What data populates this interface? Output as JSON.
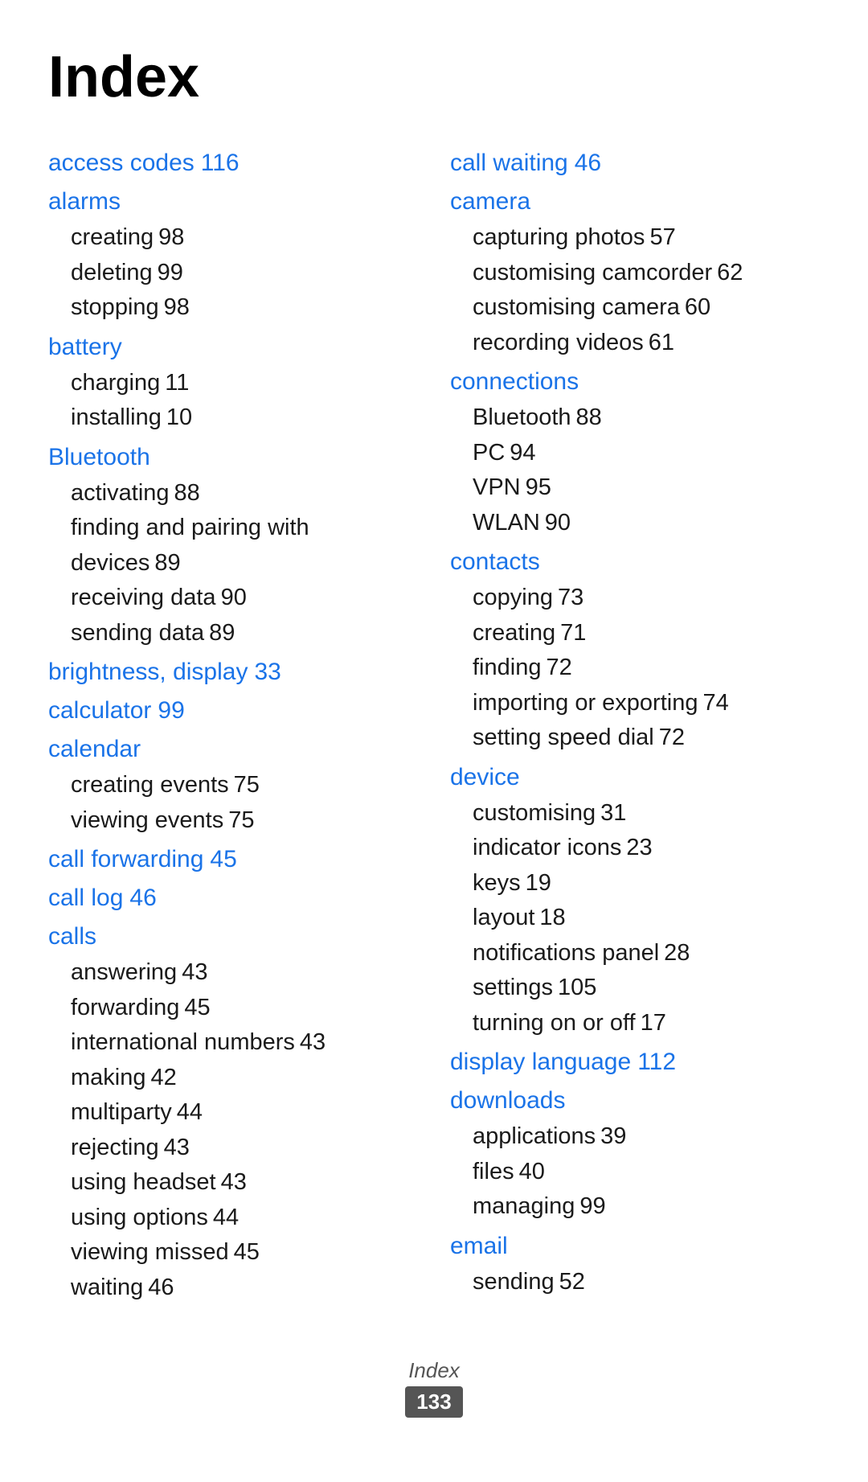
{
  "title": "Index",
  "columns": [
    {
      "entries": [
        {
          "label": "access codes",
          "page": "116",
          "subs": []
        },
        {
          "label": "alarms",
          "page": "",
          "subs": [
            {
              "text": "creating",
              "page": "98"
            },
            {
              "text": "deleting",
              "page": "99"
            },
            {
              "text": "stopping",
              "page": "98"
            }
          ]
        },
        {
          "label": "battery",
          "page": "",
          "subs": [
            {
              "text": "charging",
              "page": "11"
            },
            {
              "text": "installing",
              "page": "10"
            }
          ]
        },
        {
          "label": "Bluetooth",
          "page": "",
          "subs": [
            {
              "text": "activating",
              "page": "88"
            },
            {
              "text": "finding and pairing with devices",
              "page": "89"
            },
            {
              "text": "receiving data",
              "page": "90"
            },
            {
              "text": "sending data",
              "page": "89"
            }
          ]
        },
        {
          "label": "brightness, display",
          "page": "33",
          "subs": []
        },
        {
          "label": "calculator",
          "page": "99",
          "subs": []
        },
        {
          "label": "calendar",
          "page": "",
          "subs": [
            {
              "text": "creating events",
              "page": "75"
            },
            {
              "text": "viewing events",
              "page": "75"
            }
          ]
        },
        {
          "label": "call forwarding",
          "page": "45",
          "subs": []
        },
        {
          "label": "call log",
          "page": "46",
          "subs": []
        },
        {
          "label": "calls",
          "page": "",
          "subs": [
            {
              "text": "answering",
              "page": "43"
            },
            {
              "text": "forwarding",
              "page": "45"
            },
            {
              "text": "international numbers",
              "page": "43"
            },
            {
              "text": "making",
              "page": "42"
            },
            {
              "text": "multiparty",
              "page": "44"
            },
            {
              "text": "rejecting",
              "page": "43"
            },
            {
              "text": "using headset",
              "page": "43"
            },
            {
              "text": "using options",
              "page": "44"
            },
            {
              "text": "viewing missed",
              "page": "45"
            },
            {
              "text": "waiting",
              "page": "46"
            }
          ]
        }
      ]
    },
    {
      "entries": [
        {
          "label": "call waiting",
          "page": "46",
          "subs": []
        },
        {
          "label": "camera",
          "page": "",
          "subs": [
            {
              "text": "capturing photos",
              "page": "57"
            },
            {
              "text": "customising camcorder",
              "page": "62"
            },
            {
              "text": "customising camera",
              "page": "60"
            },
            {
              "text": "recording videos",
              "page": "61"
            }
          ]
        },
        {
          "label": "connections",
          "page": "",
          "subs": [
            {
              "text": "Bluetooth",
              "page": "88"
            },
            {
              "text": "PC",
              "page": "94"
            },
            {
              "text": "VPN",
              "page": "95"
            },
            {
              "text": "WLAN",
              "page": "90"
            }
          ]
        },
        {
          "label": "contacts",
          "page": "",
          "subs": [
            {
              "text": "copying",
              "page": "73"
            },
            {
              "text": "creating",
              "page": "71"
            },
            {
              "text": "finding",
              "page": "72"
            },
            {
              "text": "importing or exporting",
              "page": "74"
            },
            {
              "text": "setting speed dial",
              "page": "72"
            }
          ]
        },
        {
          "label": "device",
          "page": "",
          "subs": [
            {
              "text": "customising",
              "page": "31"
            },
            {
              "text": "indicator icons",
              "page": "23"
            },
            {
              "text": "keys",
              "page": "19"
            },
            {
              "text": "layout",
              "page": "18"
            },
            {
              "text": "notifications panel",
              "page": "28"
            },
            {
              "text": "settings",
              "page": "105"
            },
            {
              "text": "turning on or off",
              "page": "17"
            }
          ]
        },
        {
          "label": "display language",
          "page": "112",
          "subs": []
        },
        {
          "label": "downloads",
          "page": "",
          "subs": [
            {
              "text": "applications",
              "page": "39"
            },
            {
              "text": "files",
              "page": "40"
            },
            {
              "text": "managing",
              "page": "99"
            }
          ]
        },
        {
          "label": "email",
          "page": "",
          "subs": [
            {
              "text": "sending",
              "page": "52"
            }
          ]
        }
      ]
    }
  ],
  "footer": {
    "label": "Index",
    "page": "133"
  }
}
